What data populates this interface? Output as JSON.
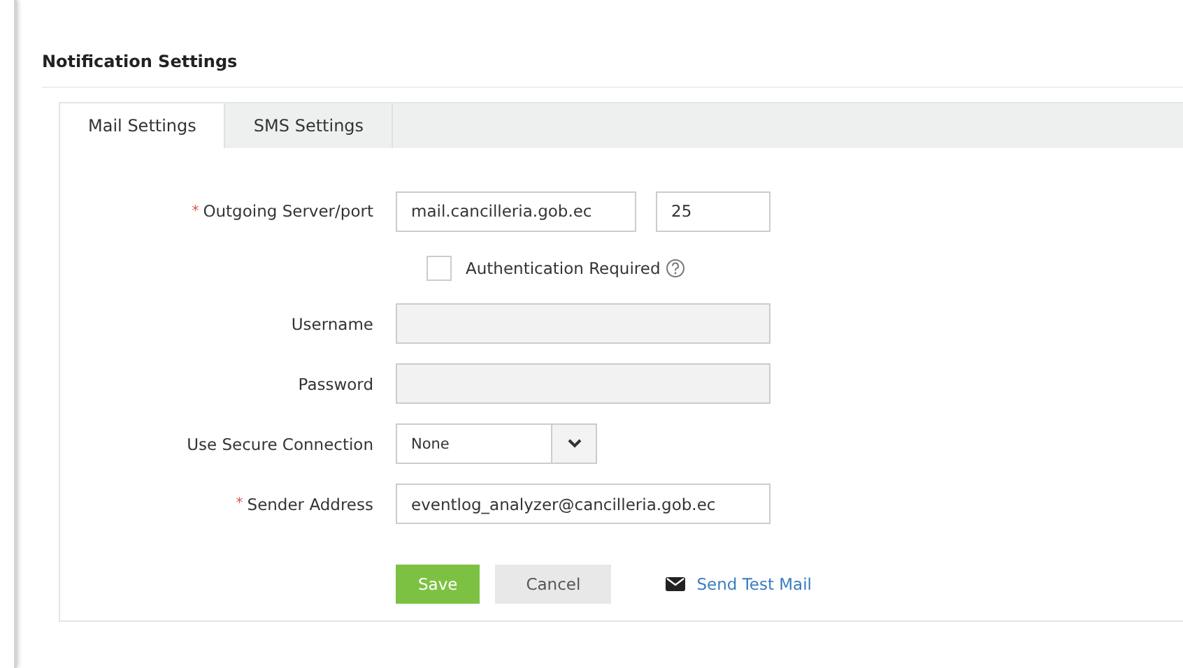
{
  "title": "Notification Settings",
  "tabs": [
    {
      "label": "Mail Settings",
      "selected": true
    },
    {
      "label": "SMS Settings",
      "selected": false
    }
  ],
  "form": [
    {
      "kind": "server",
      "mark": "*",
      "label": "Outgoing Server/port",
      "value": "mail.cancilleria.gob.ec",
      "port": "25"
    },
    {
      "kind": "checkbox",
      "label": "Authentication Required",
      "checked": false
    },
    {
      "kind": "text",
      "label": "Username",
      "disabled": true
    },
    {
      "kind": "text",
      "label": "Password",
      "disabled": true
    },
    {
      "kind": "select",
      "label": "Use Secure Connection",
      "value": "None"
    },
    {
      "kind": "text",
      "mark": "*",
      "label": "Sender Address",
      "disabled": false,
      "value": "eventlog_analyzer@cancilleria.gob.ec"
    }
  ],
  "buttons": [
    {
      "kind": "primary",
      "label": "Save"
    },
    {
      "kind": "secondary",
      "label": "Cancel"
    }
  ],
  "link": {
    "label": "Send Test Mail"
  }
}
